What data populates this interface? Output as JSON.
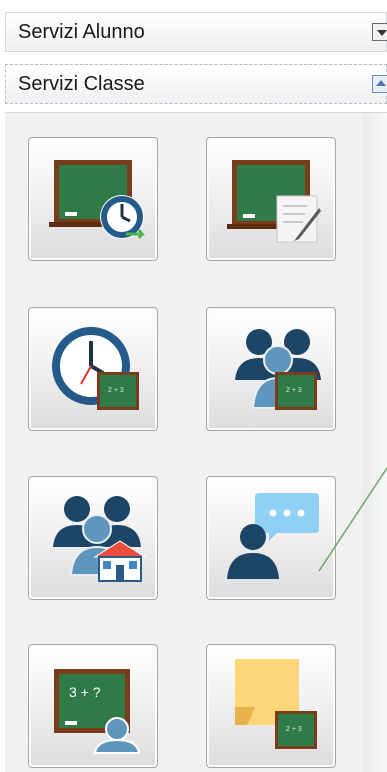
{
  "panels": {
    "alunno": {
      "label": "Servizi Alunno",
      "toggle_icon": "collapse-down-icon"
    },
    "classe": {
      "label": "Servizi Classe",
      "toggle_icon": "collapse-up-icon"
    }
  },
  "tiles": [
    {
      "icon": "blackboard-clock-icon"
    },
    {
      "icon": "blackboard-edit-icon"
    },
    {
      "icon": "clock-blackboard-icon"
    },
    {
      "icon": "people-blackboard-icon"
    },
    {
      "icon": "people-school-icon"
    },
    {
      "icon": "person-chat-icon"
    },
    {
      "icon": "blackboard-math-student-icon"
    },
    {
      "icon": "sticky-note-blackboard-icon"
    }
  ],
  "colors": {
    "board_green": "#2f7a47",
    "board_frame": "#7a3d1c",
    "clock_blue": "#245b8a",
    "people_dark": "#1c4566",
    "people_light": "#5f96bd",
    "chat_bubble": "#8fd0f5",
    "note_yellow": "#fdd67a",
    "connector_line": "#6aaa64"
  }
}
